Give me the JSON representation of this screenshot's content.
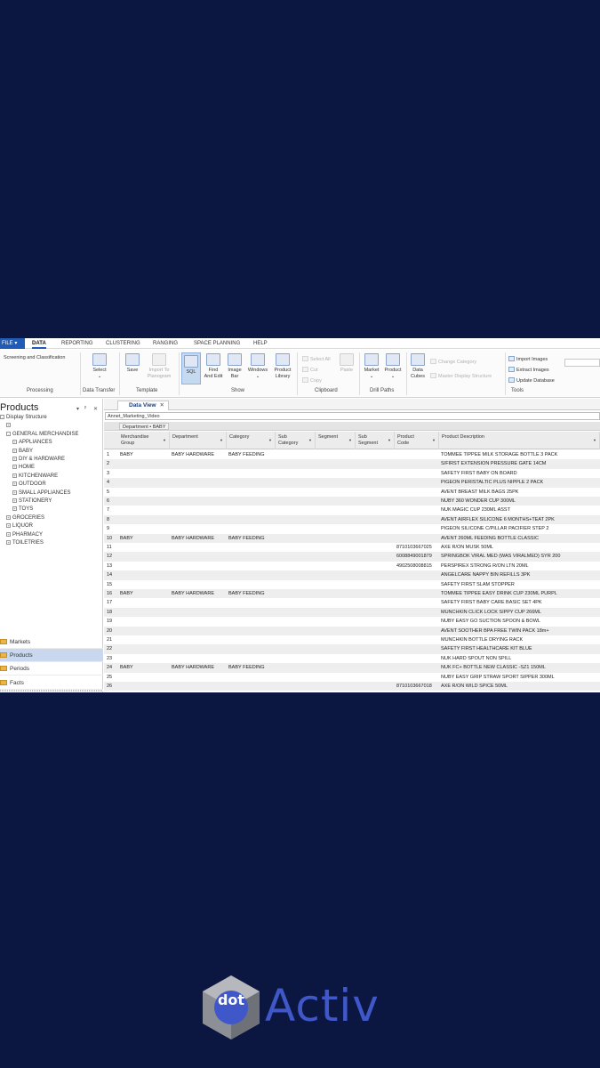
{
  "menu": {
    "file": "FILE",
    "tabs": [
      "DATA",
      "REPORTING",
      "CLUSTERING",
      "RANGING",
      "SPACE PLANNING",
      "HELP"
    ]
  },
  "ribbon": {
    "processing": {
      "item": "Screening and Classification",
      "label": "Processing"
    },
    "data_transfer": {
      "select": "Select",
      "label": "Data Transfer"
    },
    "template": {
      "save": "Save",
      "import_line1": "Import To",
      "import_line2": "Planogram",
      "label": "Template"
    },
    "show": {
      "sql": "SQL",
      "find_line1": "Find",
      "find_line2": "And Edit",
      "image_line1": "Image",
      "image_line2": "Bar",
      "windows": "Windows",
      "library_line1": "Product",
      "library_line2": "Library",
      "label": "Show"
    },
    "clipboard": {
      "select_all": "Select All",
      "cut": "Cut",
      "copy": "Copy",
      "paste": "Paste",
      "label": "Clipboard"
    },
    "drill_paths": {
      "market": "Market",
      "product": "Product",
      "label": "Drill Paths"
    },
    "tools": {
      "data_line1": "Data",
      "data_line2": "Cubes",
      "change_category": "Change Category",
      "master_display": "Master Display Structure",
      "import_images": "Import Images",
      "extract_images": "Extract Images",
      "update_database": "Update Database",
      "label": "Tools"
    }
  },
  "panel": {
    "title": "Products",
    "pin": "ᵖ",
    "close": "✕",
    "tree": [
      {
        "label": "Display Structure",
        "indent": 0,
        "exp": "-"
      },
      {
        "label": "",
        "indent": 1,
        "exp": "+"
      },
      {
        "label": "GENERAL MERCHANDISE",
        "indent": 1,
        "exp": "-"
      },
      {
        "label": "APPLIANCES",
        "indent": 2,
        "exp": "+"
      },
      {
        "label": "BABY",
        "indent": 2,
        "exp": "+"
      },
      {
        "label": "DIY & HARDWARE",
        "indent": 2,
        "exp": "+"
      },
      {
        "label": "HOME",
        "indent": 2,
        "exp": "+"
      },
      {
        "label": "KITCHENWARE",
        "indent": 2,
        "exp": "+"
      },
      {
        "label": "OUTDOOR",
        "indent": 2,
        "exp": "+"
      },
      {
        "label": "SMALL APPLIANCES",
        "indent": 2,
        "exp": "+"
      },
      {
        "label": "STATIONERY",
        "indent": 2,
        "exp": "+"
      },
      {
        "label": "TOYS",
        "indent": 2,
        "exp": "+"
      },
      {
        "label": "GROCERIES",
        "indent": 1,
        "exp": "+"
      },
      {
        "label": "LIQUOR",
        "indent": 1,
        "exp": "+"
      },
      {
        "label": "PHARMACY",
        "indent": 1,
        "exp": "+"
      },
      {
        "label": "TOILETRIES",
        "indent": 1,
        "exp": "+"
      }
    ],
    "nav": [
      "Markets",
      "Products",
      "Periods",
      "Facts"
    ],
    "nav_active": "Products"
  },
  "dataview": {
    "tab": "Data View",
    "tab_close": "✕",
    "filter": "Annet_Marketing_Video",
    "group_chip": "Department • BABY",
    "columns": [
      {
        "label1": "Merchandise",
        "label2": "Group"
      },
      {
        "label1": "Department",
        "label2": ""
      },
      {
        "label1": "Category",
        "label2": ""
      },
      {
        "label1": "Sub",
        "label2": "Category"
      },
      {
        "label1": "Segment",
        "label2": ""
      },
      {
        "label1": "Sub",
        "label2": "Segment"
      },
      {
        "label1": "Product",
        "label2": "Code"
      },
      {
        "label1": "Product Description",
        "label2": ""
      }
    ],
    "rows": [
      [
        "1",
        "BABY",
        "BABY HARDWARE",
        "BABY FEEDING",
        "",
        "TOMMEE TIPPEE MILK STORAGE BOTTLE 3 PACK"
      ],
      [
        "2",
        "",
        "",
        "",
        "",
        "S/FIRST EXTENSION PRESSURE GATE 14CM"
      ],
      [
        "3",
        "",
        "",
        "",
        "",
        "SAFETY FIRST BABY ON BOARD"
      ],
      [
        "4",
        "",
        "",
        "",
        "",
        "PIGEON PERISTALTIC PLUS NIPPLE 2 PACK"
      ],
      [
        "5",
        "",
        "",
        "",
        "",
        "AVENT BREAST MILK BAGS 25PK"
      ],
      [
        "6",
        "",
        "",
        "",
        "",
        "NUBY 360 WONDER CUP 300ML"
      ],
      [
        "7",
        "",
        "",
        "",
        "",
        "NUK MAGIC CUP 230ML ASST"
      ],
      [
        "8",
        "",
        "",
        "",
        "",
        "AVENT AIRFLEX SILICONE 6 MONTHS+TEAT 2PK"
      ],
      [
        "9",
        "",
        "",
        "",
        "",
        "PIGEON SILICONE C/PILLAR PACIFIER STEP 2"
      ],
      [
        "10",
        "BABY",
        "BABY HARDWARE",
        "BABY FEEDING",
        "",
        "AVENT 260ML FEEDING BOTTLE CLASSIC"
      ],
      [
        "11",
        "",
        "",
        "",
        "8710103667025",
        "AXE R/ON MUSK 50ML"
      ],
      [
        "12",
        "",
        "",
        "",
        "6008849001879",
        "SPRINGBOK VIRAL MED (WAS VIRALMED) SYR 200"
      ],
      [
        "13",
        "",
        "",
        "",
        "4902508008815",
        "PERSPIREX STRONG R/ON LTN 20ML"
      ],
      [
        "14",
        "",
        "",
        "",
        "",
        "ANGELCARE NAPPY BIN REFILLS 3PK"
      ],
      [
        "15",
        "",
        "",
        "",
        "",
        "SAFETY FIRST SLAM STOPPER"
      ],
      [
        "16",
        "BABY",
        "BABY HARDWARE",
        "BABY FEEDING",
        "",
        "TOMMEE TIPPEE EASY DRINK CUP 230ML PURPL"
      ],
      [
        "17",
        "",
        "",
        "",
        "",
        "SAFETY FIRST BABY CARE BASIC SET 4PK"
      ],
      [
        "18",
        "",
        "",
        "",
        "",
        "MUNCHKIN CLICK LOCK SIPPY CUP 266ML"
      ],
      [
        "19",
        "",
        "",
        "",
        "",
        "NUBY EASY GO SUCTION SPOON & BOWL"
      ],
      [
        "20",
        "",
        "",
        "",
        "",
        "AVENT SOOTHER BPA FREE TWIN PACK 18m+"
      ],
      [
        "21",
        "",
        "",
        "",
        "",
        "MUNCHKIN BOTTLE DRYING RACK"
      ],
      [
        "22",
        "",
        "",
        "",
        "",
        "SAFETY FIRST HEALTHCARE KIT BLUE"
      ],
      [
        "23",
        "",
        "",
        "",
        "",
        "NUK HARD SPOUT NON SPILL"
      ],
      [
        "24",
        "BABY",
        "BABY HARDWARE",
        "BABY FEEDING",
        "",
        "NUK FC+ BOTTLE NEW CLASSIC -SZ1 150ML"
      ],
      [
        "25",
        "",
        "",
        "",
        "",
        "NUBY EASY GRIP STRAW SPORT SIPPER 300ML"
      ],
      [
        "26",
        "",
        "",
        "",
        "8710103667018",
        "AXE R/ON WILD SPICE 50ML"
      ]
    ]
  },
  "logo": {
    "dot": "dot",
    "word": "Activ"
  },
  "colors": {
    "background": "#0b1740",
    "accent": "#1f5bb7",
    "logo_blue": "#3f57c8",
    "active_nav": "#c9d8ef"
  }
}
